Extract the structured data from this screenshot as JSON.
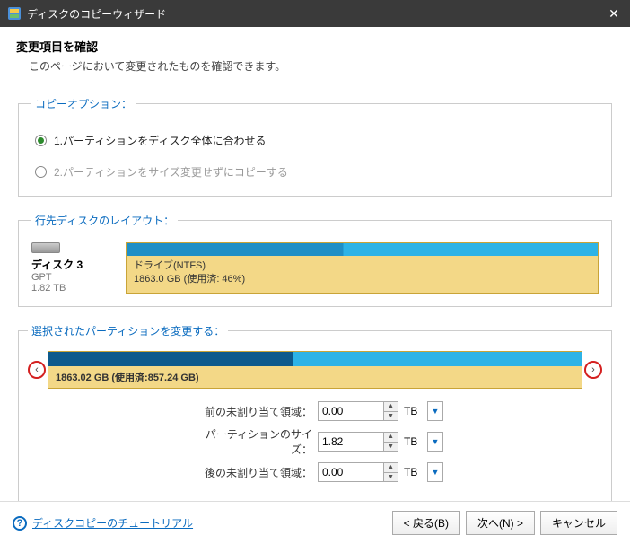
{
  "titlebar": {
    "title": "ディスクのコピーウィザード"
  },
  "header": {
    "title": "変更項目を確認",
    "subtitle": "このページにおいて変更されたものを確認できます。"
  },
  "copyOptions": {
    "legend": "コピーオプション：",
    "opt1": "1.パーティションをディスク全体に合わせる",
    "opt2": "2.パーティションをサイズ変更せずにコピーする"
  },
  "layout": {
    "legend": "行先ディスクのレイアウト：",
    "diskName": "ディスク 3",
    "diskType": "GPT",
    "diskSize": "1.82 TB",
    "partLine1": "ドライブ(NTFS)",
    "partLine2": "1863.0 GB (使用済: 46%)"
  },
  "resize": {
    "legend": "選択されたパーティションを変更する：",
    "barText": "1863.02 GB (使用済:857.24 GB)"
  },
  "fields": {
    "beforeLabel": "前の未割り当て領域：",
    "beforeValue": "0.00",
    "sizeLabel": "パーティションのサイズ：",
    "sizeValue": "1.82",
    "afterLabel": "後の未割り当て領域：",
    "afterValue": "0.00",
    "unit": "TB"
  },
  "footer": {
    "helpLink": "ディスクコピーのチュートリアル",
    "back": "< 戻る(B)",
    "next": "次へ(N) >",
    "cancel": "キャンセル"
  }
}
